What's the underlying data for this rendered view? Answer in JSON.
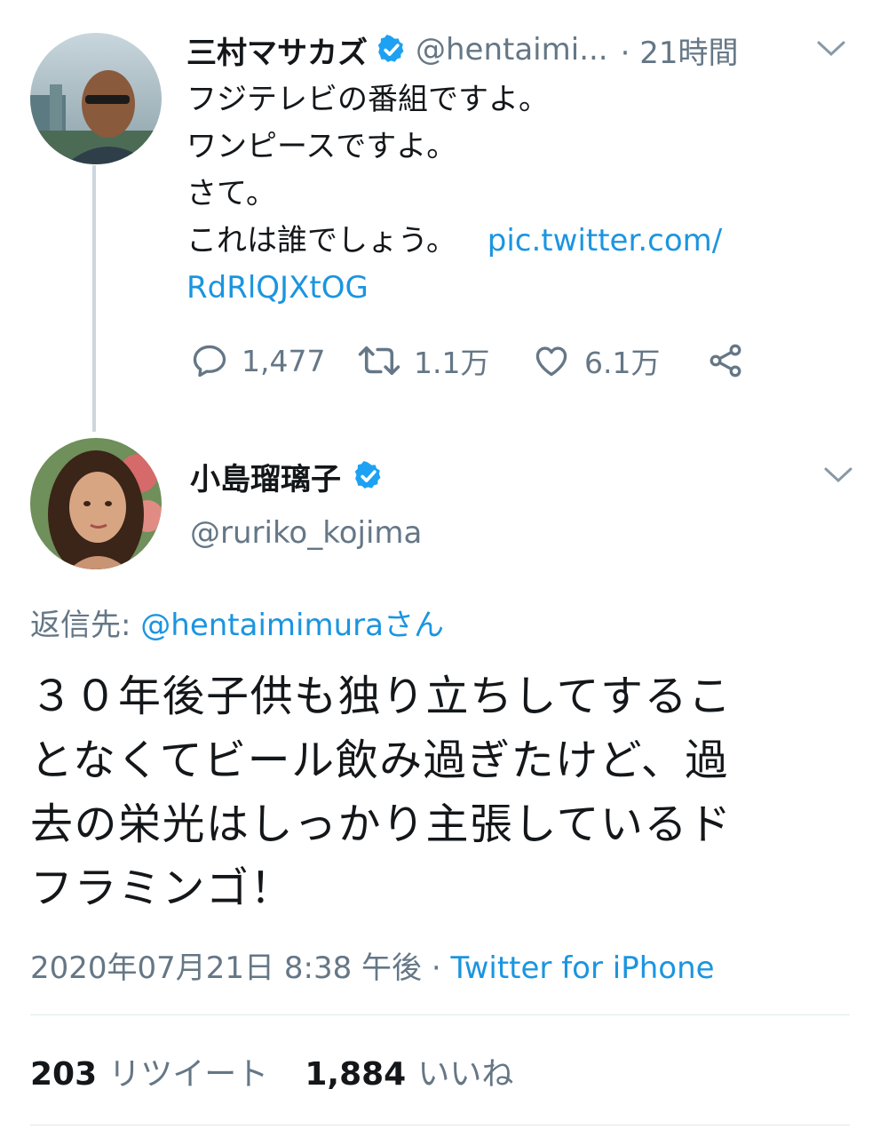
{
  "tweet1": {
    "name": "三村マサカズ",
    "handle": "@hentaimi...",
    "time": "· 21時間",
    "lines": [
      "フジテレビの番組ですよ。",
      "ワンピースですよ。",
      "さて。",
      "これは誰でしょう。"
    ],
    "link_part1": "pic.twitter.com/",
    "link_part2": "RdRlQJXtOG",
    "replies": "1,477",
    "retweets": "1.1万",
    "likes": "6.1万"
  },
  "tweet2": {
    "name": "小島瑠璃子",
    "handle": "@ruriko_kojima",
    "reply_prefix": "返信先: ",
    "reply_handle": "@hentaimimuraさん",
    "text_lines": [
      "３０年後子供も独り立ちしてするこ",
      "となくてビール飲み過ぎたけど、過",
      "去の栄光はしっかり主張しているド",
      "フラミンゴ！"
    ],
    "timestamp": "2020年07月21日 8:38 午後 · ",
    "source": "Twitter for iPhone",
    "retweet_count": "203",
    "retweet_label": "リツイート",
    "like_count": "1,884",
    "like_label": "いいね"
  },
  "colors": {
    "link": "#1b95e0",
    "muted": "#657786",
    "verified": "#1da1f2",
    "line": "#ccd6dd"
  }
}
